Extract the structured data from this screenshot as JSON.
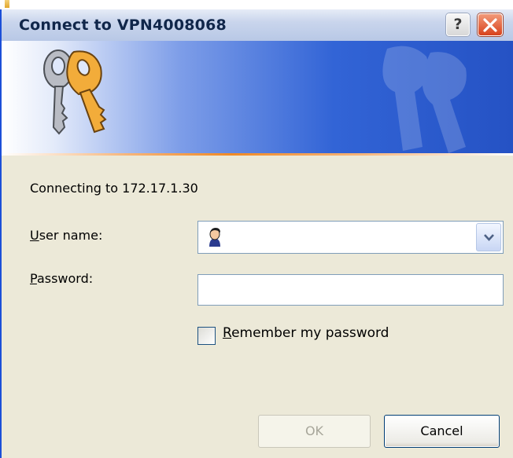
{
  "window": {
    "title": "Connect to VPN4008068"
  },
  "titlebar_buttons": {
    "help_label": "?",
    "close_icon": "close-icon"
  },
  "status": {
    "connecting_text": "Connecting to 172.17.1.30"
  },
  "form": {
    "username_label_mnemonic": "U",
    "username_label_rest": "ser name:",
    "username_value": "",
    "password_label_mnemonic": "P",
    "password_label_rest": "assword:",
    "password_value": "",
    "remember_mnemonic": "R",
    "remember_rest": "emember my password",
    "remember_checked": false
  },
  "buttons": {
    "ok_label": "OK",
    "ok_enabled": false,
    "cancel_label": "Cancel"
  },
  "colors": {
    "titlebar": "#c9d5ec",
    "banner_blue": "#3264d6",
    "banner_accent": "#f08a26",
    "dialog_bg": "#ece9d8",
    "close_button": "#d8421c"
  }
}
